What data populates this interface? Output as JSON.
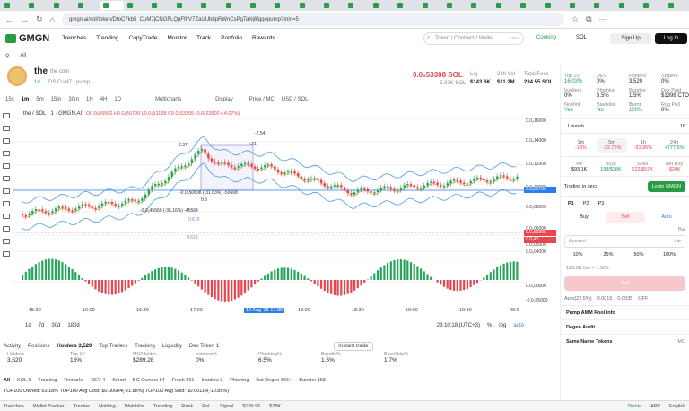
{
  "browser": {
    "tabs": [
      "",
      "",
      "",
      "",
      "",
      "",
      "",
      "",
      "",
      "",
      "",
      "",
      "",
      "",
      "",
      "",
      "",
      "",
      "",
      "",
      "",
      "",
      "",
      "",
      "",
      "",
      "",
      ""
    ],
    "url": "gmgn.ai/sol/token/DtoC7kb5_CuM7jCNGFLQpFfhV7ZaUUb8pRWnCsPgTaNj6fgq4pump?min=5"
  },
  "nav": {
    "logo": "GMGN",
    "items": [
      "Trenches",
      "Trending",
      "CopyTrade",
      "Monitor",
      "Track",
      "Portfolio",
      "Rewards"
    ],
    "search_placeholder": "Token / Contract / Wallet",
    "search_shortcut": "Ctrl+K",
    "cooking": "Cooking",
    "chain": "SOL",
    "sign_up": "Sign Up",
    "login": "Log In"
  },
  "filterbar": {
    "all": "All"
  },
  "token": {
    "symbol": "the",
    "name": "the coin",
    "age": "1d",
    "holders_short": "DS",
    "contract": "CuM7...pump",
    "price": "0.0₅53308 SOL",
    "mc": "5.33K SOL",
    "liq_label": "Liq",
    "liq": "$143.6K",
    "vol_label": "24h Vol",
    "vol": "$11.2M",
    "fees_label": "Total Fees",
    "fees": "234.55 SOL"
  },
  "chart_tools": {
    "intervals": [
      "15s",
      "1m",
      "5m",
      "15m",
      "30m",
      "1H",
      "4H",
      "1D"
    ],
    "multicharts": "Multicharts",
    "display": "Display",
    "price_mc": "Price / MC",
    "usd_sol": "USD / SOL"
  },
  "chart": {
    "symbol_line": "the / SOL · 1 · GMGN.AI",
    "ohlc": "O0.0₅55562 H0.0₅55799 L0.0₅51138 C0.0₅53305 -0.0₅22600 (-4.07%)",
    "annotations": [
      "2.37",
      "4.31",
      "-2.54",
      "-0.0₅50608 (-31.63%) -50608",
      "-0.0₅45560 (-35.16%) -45564",
      "0.616",
      "0.5",
      "0.618"
    ],
    "price_labels": [
      "0.0₅16000",
      "0.0₅14000",
      "0.0₅12000",
      "0.0₅10000",
      "0.0₅08000",
      "0.0₅06000",
      "0.0₅05000",
      "0.0₅04000",
      "0.0₅00000",
      "-0.0₅05000"
    ],
    "tags": {
      "current": "0.0₅53305",
      "last": "0.0₅05735",
      "tag2": "0.0₅41"
    },
    "time_labels": [
      "15:30",
      "16:00",
      "16:30",
      "17:00",
      "12 Aug '25  17:39",
      "18:00",
      "18:30",
      "19:00",
      "19:30",
      "20:0"
    ],
    "ranges": [
      "1d",
      "7d",
      "30d",
      "180d"
    ],
    "clock": "23:10:18 (UTC+3)",
    "log": "log",
    "auto": "auto"
  },
  "bottom": {
    "tabs": [
      "Activity",
      "Positions",
      "Holders 3,520",
      "Top Traders",
      "Tracking",
      "Liquidity",
      "Dev Token 1"
    ],
    "instant_trade": "Instant trade",
    "stats": [
      {
        "label": "Holders",
        "value": "3,520"
      },
      {
        "label": "Top 10",
        "value": "16%"
      },
      {
        "label": "MC/Holder",
        "value": "$289.28"
      },
      {
        "label": "Insiders%",
        "value": "0%"
      },
      {
        "label": "Phishing%",
        "value": "6.5%"
      },
      {
        "label": "Bundle%",
        "value": "1.5%"
      },
      {
        "label": "BlueChip%",
        "value": "1.7%"
      }
    ],
    "subtabs": [
      "All",
      "KOL 9",
      "Tracking",
      "Remarks",
      "DEV 4",
      "Smart",
      "BC Owners 84",
      "Fresh 661",
      "Insiders 3",
      "Phishing",
      "Bot Degen 666+",
      "Bundler 158"
    ],
    "top100": "TOP100 Owned: 63.18%   TOP100 Avg Cost: $0.00084(-21.88%)   TOP100 Avg Sold: $0.00114(-10.85%)"
  },
  "status": {
    "items": [
      "Trenches",
      "Wallet Tracker",
      "Tracker",
      "Holding",
      "Watchlist",
      "Trending",
      "Rank",
      "PnL",
      "Signal",
      "$189.96",
      "$78K"
    ],
    "stable": "Stable",
    "app": "APP",
    "lang": "English"
  },
  "right": {
    "stats": [
      {
        "label": "Top 10",
        "value": "16.03%",
        "color": "green"
      },
      {
        "label": "DEV",
        "value": "0%",
        "color": "dark"
      },
      {
        "label": "Holders",
        "value": "3,520",
        "color": "dark"
      },
      {
        "label": "Snipers",
        "value": "0%",
        "color": "dark"
      },
      {
        "label": "Insiders",
        "value": "0%",
        "color": "dark"
      },
      {
        "label": "Phishing",
        "value": "6.5%",
        "color": "dark"
      },
      {
        "label": "Bundler",
        "value": "1.5%",
        "color": "dark"
      },
      {
        "label": "Dex Paid",
        "value": "$1398 CTO",
        "color": "dark"
      },
      {
        "label": "NoMint",
        "value": "Yes",
        "color": "green"
      },
      {
        "label": "Blacklist",
        "value": "No",
        "color": "green"
      },
      {
        "label": "Burnt",
        "value": "100%",
        "color": "green"
      },
      {
        "label": "Rug Pull",
        "value": "0%",
        "color": "dark"
      }
    ],
    "launch": "Launch",
    "launch_count": "16",
    "timeframes": [
      {
        "label": "1m",
        "value": "-13%",
        "color": "red"
      },
      {
        "label": "5m",
        "value": "-22.72%",
        "color": "red"
      },
      {
        "label": "1h",
        "value": "-31.95%",
        "color": "red"
      },
      {
        "label": "24h",
        "value": "+777.5%",
        "color": "green"
      }
    ],
    "vol_row": [
      {
        "label": "Vol",
        "value": "$93.1K",
        "color": "dark"
      },
      {
        "label": "Buys",
        "value": "198/$38K",
        "color": "green"
      },
      {
        "label": "Sells",
        "value": "122/$57K",
        "color": "red"
      },
      {
        "label": "Net Buy",
        "value": "-$20K",
        "color": "red"
      }
    ],
    "trading_in_secs": "Trading in secs",
    "login_gmgn": "Login GMGN",
    "presets": [
      "P1",
      "P2",
      "P3"
    ],
    "buy": "Buy",
    "sell": "Sell",
    "auto": "Auto",
    "amount_label": "Amount",
    "amount_unit": "the",
    "pcts": [
      "10%",
      "25%",
      "50%",
      "100%"
    ],
    "balance": "186.5K the ≈ 1 SOL",
    "bal_label": "Bal",
    "sell_btn": "Sell",
    "settings": [
      "Auto(22.5%)",
      "0.0015",
      "0.0035",
      "OFF"
    ],
    "pool_info": "Pump AMM Pool info",
    "degen_audit": "Degen Audit",
    "same_name": "Same Name Tokens",
    "mc": "MC"
  }
}
